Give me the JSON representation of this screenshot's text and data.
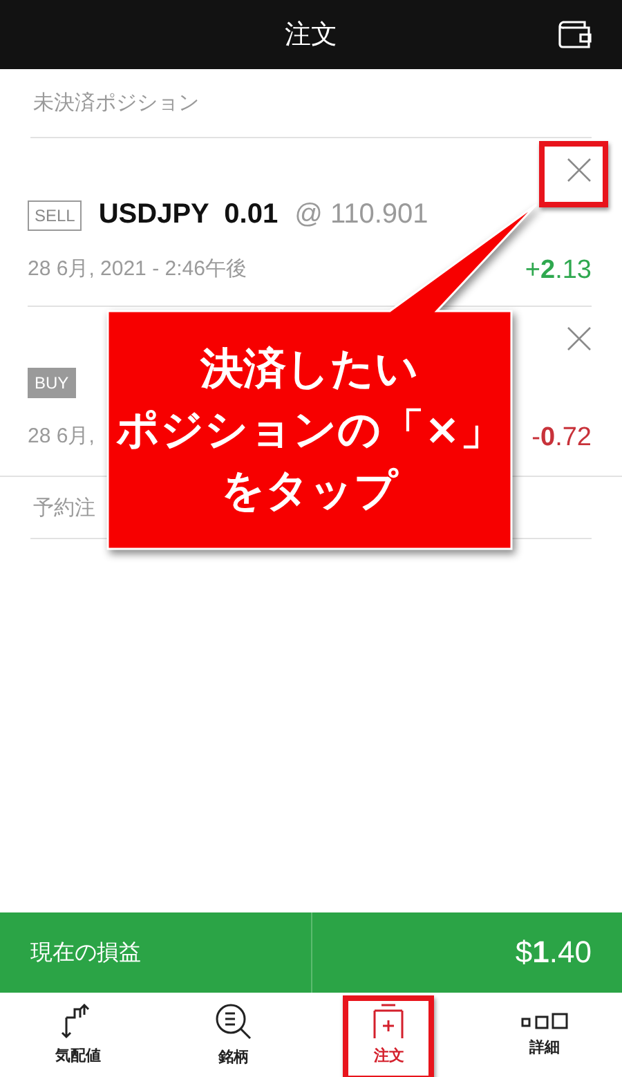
{
  "header": {
    "title": "注文"
  },
  "open_positions": {
    "heading": "未決済ポジション",
    "positions": [
      {
        "side": "SELL",
        "kind": "sell",
        "symbol": "USDJPY  0.01",
        "price": "@ 110.901",
        "date": "28 6月, 2021 - 2:46午後",
        "pnl": "+**2**.13",
        "color": "#2fa84f"
      },
      {
        "side": "BUY",
        "kind": "buy",
        "date": "28 6月,",
        "pnl": "-**0**.72",
        "color": "#c8323a"
      }
    ]
  },
  "pending_orders": {
    "heading": "予約注"
  },
  "callout": {
    "lines": [
      "決済したい",
      "ポジションの「×」",
      "をタップ"
    ]
  },
  "summary_bar": {
    "label": "現在の損益",
    "value": "$**1**.40"
  },
  "bottom_nav": [
    {
      "label": "気配値",
      "selected": false
    },
    {
      "label": "銘柄",
      "selected": false
    },
    {
      "label": "注文",
      "selected": true
    },
    {
      "label": "詳細",
      "selected": false
    }
  ]
}
